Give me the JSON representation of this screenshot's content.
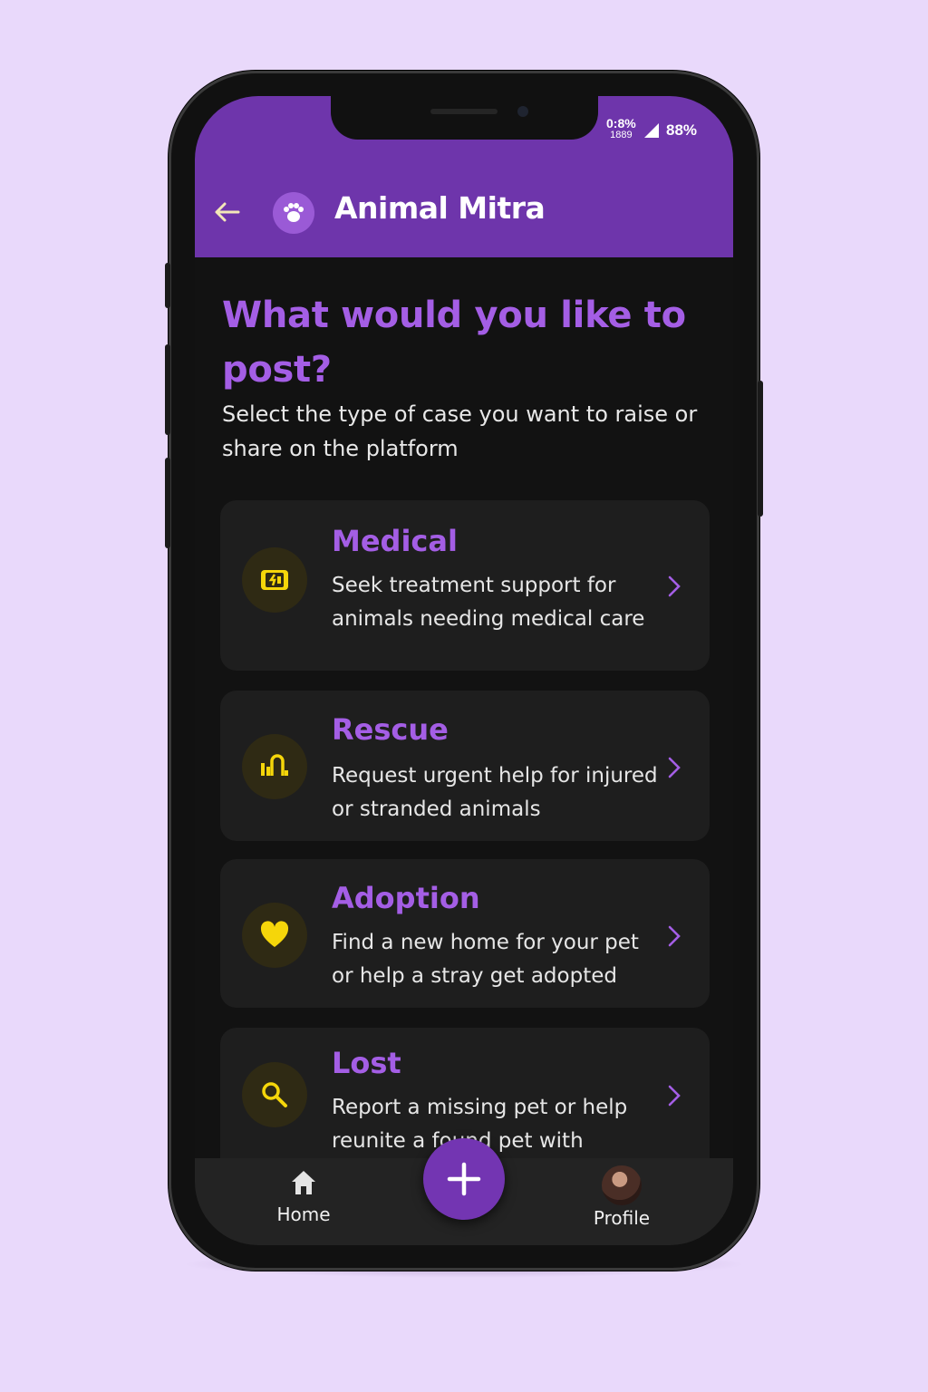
{
  "status_bar": {
    "network": "0:8%",
    "network_sub": "1889",
    "battery": "88%"
  },
  "header": {
    "title": "Animal Mitra"
  },
  "page": {
    "title": "What would you like to post?",
    "subtitle": "Select the type of case you want to raise or share on the platform"
  },
  "cards": [
    {
      "title": "Medical",
      "description": "Seek treatment support for animals needing medical care",
      "icon": "medical-kit-icon"
    },
    {
      "title": "Rescue",
      "description": "Request urgent help for injured or stranded animals",
      "icon": "rescue-icon"
    },
    {
      "title": "Adoption",
      "description": "Find a new home for your pet or help a stray get adopted",
      "icon": "heart-icon"
    },
    {
      "title": "Lost",
      "description": "Report a missing pet or help reunite a found pet with",
      "icon": "search-icon"
    }
  ],
  "bottom_nav": {
    "home_label": "Home",
    "profile_label": "Profile"
  },
  "colors": {
    "accent": "#a45ee5",
    "header": "#6e35ab",
    "icon_yellow": "#f5d60a",
    "background": "#121212"
  }
}
